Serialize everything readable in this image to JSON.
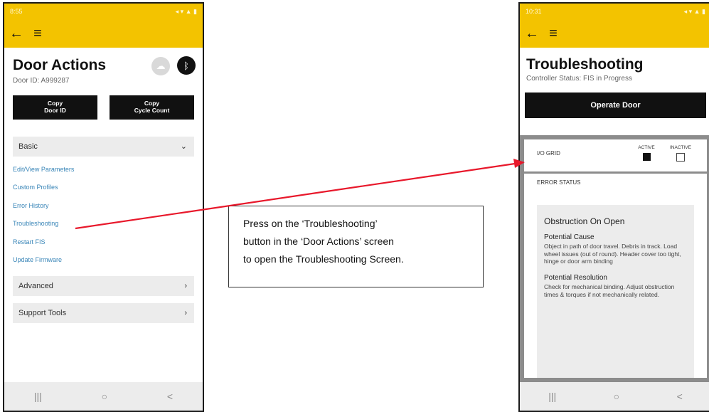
{
  "left_phone": {
    "status_time": "8:55",
    "status_icons": "◂ ▾ ▲ ▮",
    "title": "Door Actions",
    "door_id": "Door ID: A999287",
    "copy_door_id": [
      "Copy",
      "Door ID"
    ],
    "copy_cycle_count": [
      "Copy",
      "Cycle Count"
    ],
    "basic_label": "Basic",
    "basic_links": [
      "Edit/View Parameters",
      "Custom Profiles",
      "Error History",
      "Troubleshooting",
      "Restart FIS",
      "Update Firmware"
    ],
    "advanced_label": "Advanced",
    "support_label": "Support Tools"
  },
  "right_phone": {
    "status_time": "10:31",
    "status_icons": "◂ ▾ ▲ ▮",
    "title": "Troubleshooting",
    "controller_status": "Controller Status: FIS in Progress",
    "operate_label": "Operate Door",
    "io_grid_label": "I/O GRID",
    "active_label": "ACTIVE",
    "inactive_label": "INACTIVE",
    "error_status_label": "ERROR STATUS",
    "error_title": "Obstruction On Open",
    "cause_label": "Potential Cause",
    "cause_text": "Object in path of door travel. Debris in track. Load wheel issues (out of round). Header cover too tight, hinge or door arm binding",
    "resolution_label": "Potential Resolution",
    "resolution_text": "Check for mechanical binding. Adjust obstruction times & torques if not mechanically related."
  },
  "nav_icons": {
    "recent": "|||",
    "home": "○",
    "back": "<"
  },
  "callout": {
    "lines": [
      "Press on the ‘Troubleshooting’",
      "button in the ‘Door Actions’ screen",
      "to open the Troubleshooting Screen."
    ]
  },
  "colors": {
    "brand_yellow": "#f3c300",
    "arrow_red": "#e8182b",
    "link_blue": "#3a86b8"
  }
}
